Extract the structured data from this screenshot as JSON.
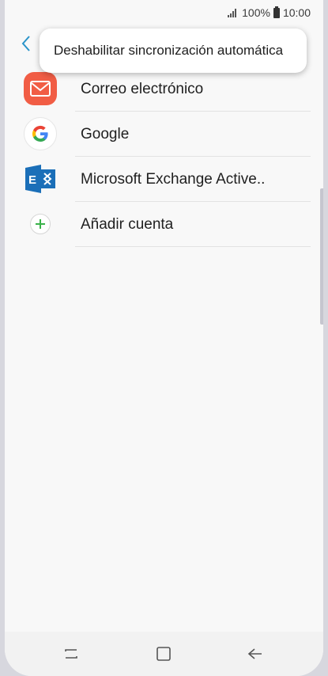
{
  "status_bar": {
    "battery_percent": "100%",
    "time": "10:00"
  },
  "popup_menu": {
    "item_label": "Deshabilitar sincronización automática"
  },
  "accounts": [
    {
      "label": "Correo electrónico",
      "icon": "email-icon",
      "color": "#f15d45"
    },
    {
      "label": "Google",
      "icon": "google-icon"
    },
    {
      "label": "Microsoft Exchange Active..",
      "icon": "exchange-icon",
      "color": "#1b6fb8"
    },
    {
      "label": "Añadir cuenta",
      "icon": "add-icon",
      "color": "#3bb24a"
    }
  ],
  "navigation": {
    "icons": [
      "recent-apps-icon",
      "home-icon",
      "back-icon"
    ]
  }
}
